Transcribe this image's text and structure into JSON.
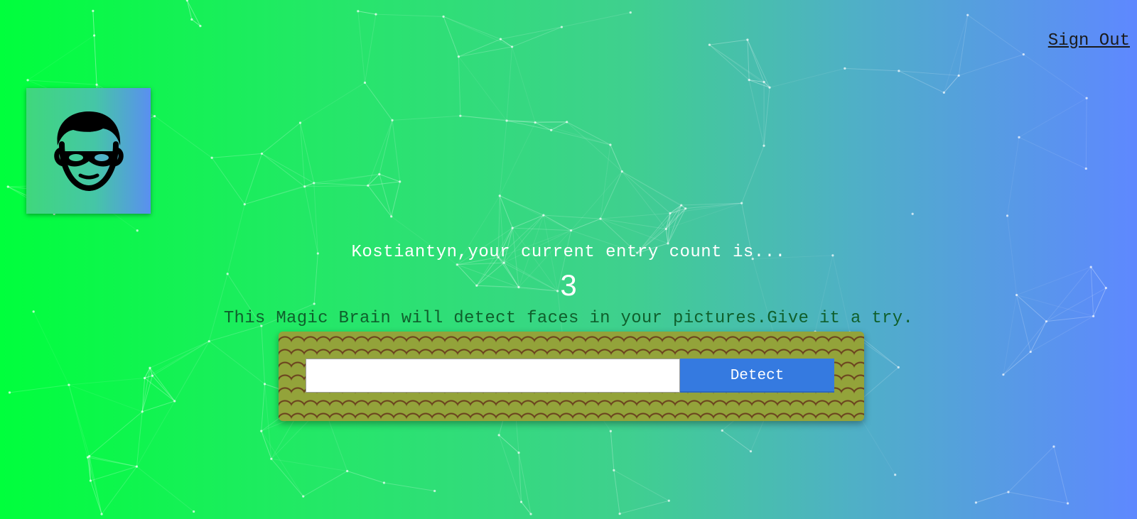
{
  "nav": {
    "signout_label": "Sign Out"
  },
  "logo": {
    "icon": "face-with-mask-icon"
  },
  "rank": {
    "greeting": "Kostiantyn,your current entry count is...",
    "count": "3"
  },
  "form": {
    "tagline": "This Magic Brain will detect faces in your pictures.Give it a try.",
    "input_value": "",
    "input_placeholder": "",
    "detect_label": "Detect"
  },
  "colors": {
    "gradient_start": "#00ff3c",
    "gradient_end": "#5e88ff",
    "button": "#357ae0",
    "pattern_base": "#93a33a",
    "tagline_text": "#0f5f2c"
  }
}
